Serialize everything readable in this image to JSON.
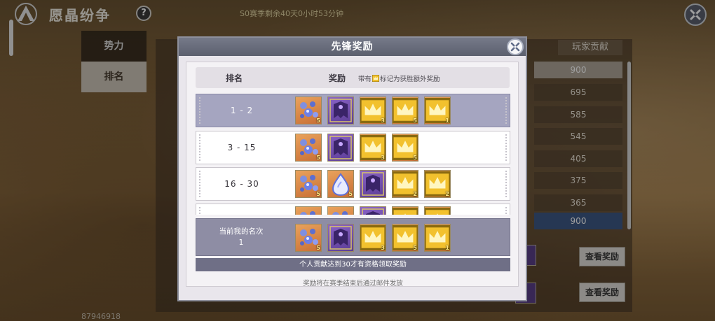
{
  "header": {
    "title": "愿晶纷争",
    "help_label": "?",
    "season_timer": "S0赛季剩余40天0小时53分钟"
  },
  "sidebar": {
    "tabs": [
      {
        "label": "势力",
        "active": false
      },
      {
        "label": "排名",
        "active": true
      }
    ]
  },
  "background_table": {
    "column_header": "玩家贡献",
    "contributions": [
      "900",
      "695",
      "585",
      "545",
      "405",
      "375",
      "365",
      "900"
    ],
    "view_reward_label": "查看奖励",
    "user_id": "87946918"
  },
  "modal": {
    "title": "先锋奖励",
    "table_header": {
      "rank": "排名",
      "reward": "奖励",
      "note_prefix": "带有",
      "note_suffix": "标记为获胜额外奖励"
    },
    "rows": [
      {
        "rank": "1 - 2",
        "highlighted": true,
        "items": [
          {
            "icon": "blue-crystal-cluster-icon",
            "frame": "orange",
            "qty": "5",
            "bonus": false
          },
          {
            "icon": "purple-cloak-icon",
            "frame": "purple",
            "qty": "",
            "bonus": false
          },
          {
            "icon": "blue-crystal-cluster-icon",
            "frame": "orange",
            "qty": "3",
            "bonus": true
          },
          {
            "icon": "blue-droplet-icon",
            "frame": "orange",
            "qty": "5",
            "bonus": true
          },
          {
            "icon": "red-lantern-icon",
            "frame": "orange",
            "qty": "1",
            "bonus": true
          }
        ]
      },
      {
        "rank": "3 - 15",
        "highlighted": false,
        "items": [
          {
            "icon": "blue-crystal-cluster-icon",
            "frame": "orange",
            "qty": "5",
            "bonus": false
          },
          {
            "icon": "purple-cloak-icon",
            "frame": "purple",
            "qty": "",
            "bonus": false
          },
          {
            "icon": "blue-crystal-cluster-icon",
            "frame": "orange",
            "qty": "3",
            "bonus": true
          },
          {
            "icon": "blue-droplet-icon",
            "frame": "orange",
            "qty": "5",
            "bonus": true
          }
        ]
      },
      {
        "rank": "16 - 30",
        "highlighted": false,
        "items": [
          {
            "icon": "blue-crystal-cluster-icon",
            "frame": "orange",
            "qty": "5",
            "bonus": false
          },
          {
            "icon": "blue-droplet-icon",
            "frame": "orange",
            "qty": "5",
            "bonus": false
          },
          {
            "icon": "purple-cloak-icon",
            "frame": "purple",
            "qty": "",
            "bonus": false
          },
          {
            "icon": "blue-crystal-cluster-icon",
            "frame": "orange",
            "qty": "2",
            "bonus": true
          },
          {
            "icon": "blue-droplet-icon",
            "frame": "orange",
            "qty": "2",
            "bonus": true
          }
        ]
      },
      {
        "rank": "",
        "highlighted": false,
        "items": [
          {
            "icon": "blue-crystal-cluster-icon",
            "frame": "orange",
            "qty": "",
            "bonus": false
          },
          {
            "icon": "blue-crystal-cluster-icon",
            "frame": "orange",
            "qty": "",
            "bonus": false
          },
          {
            "icon": "purple-cloak-icon",
            "frame": "purple",
            "qty": "",
            "bonus": false
          },
          {
            "icon": "blue-crystal-cluster-icon",
            "frame": "orange",
            "qty": "",
            "bonus": true
          },
          {
            "icon": "blue-droplet-icon",
            "frame": "orange",
            "qty": "",
            "bonus": true
          }
        ]
      }
    ],
    "my_rank": {
      "label": "当前我的名次",
      "value": "1",
      "items": [
        {
          "icon": "blue-crystal-cluster-icon",
          "frame": "orange",
          "qty": "5",
          "bonus": false
        },
        {
          "icon": "purple-cloak-icon",
          "frame": "purple",
          "qty": "",
          "bonus": false
        },
        {
          "icon": "blue-crystal-cluster-icon",
          "frame": "orange",
          "qty": "3",
          "bonus": true
        },
        {
          "icon": "blue-droplet-icon",
          "frame": "orange",
          "qty": "5",
          "bonus": true
        },
        {
          "icon": "red-lantern-icon",
          "frame": "orange",
          "qty": "1",
          "bonus": true
        }
      ]
    },
    "eligibility_notice": "个人贡献达到30才有资格领取奖励",
    "footer_note": "奖励将在赛季结束后通过邮件发放"
  }
}
